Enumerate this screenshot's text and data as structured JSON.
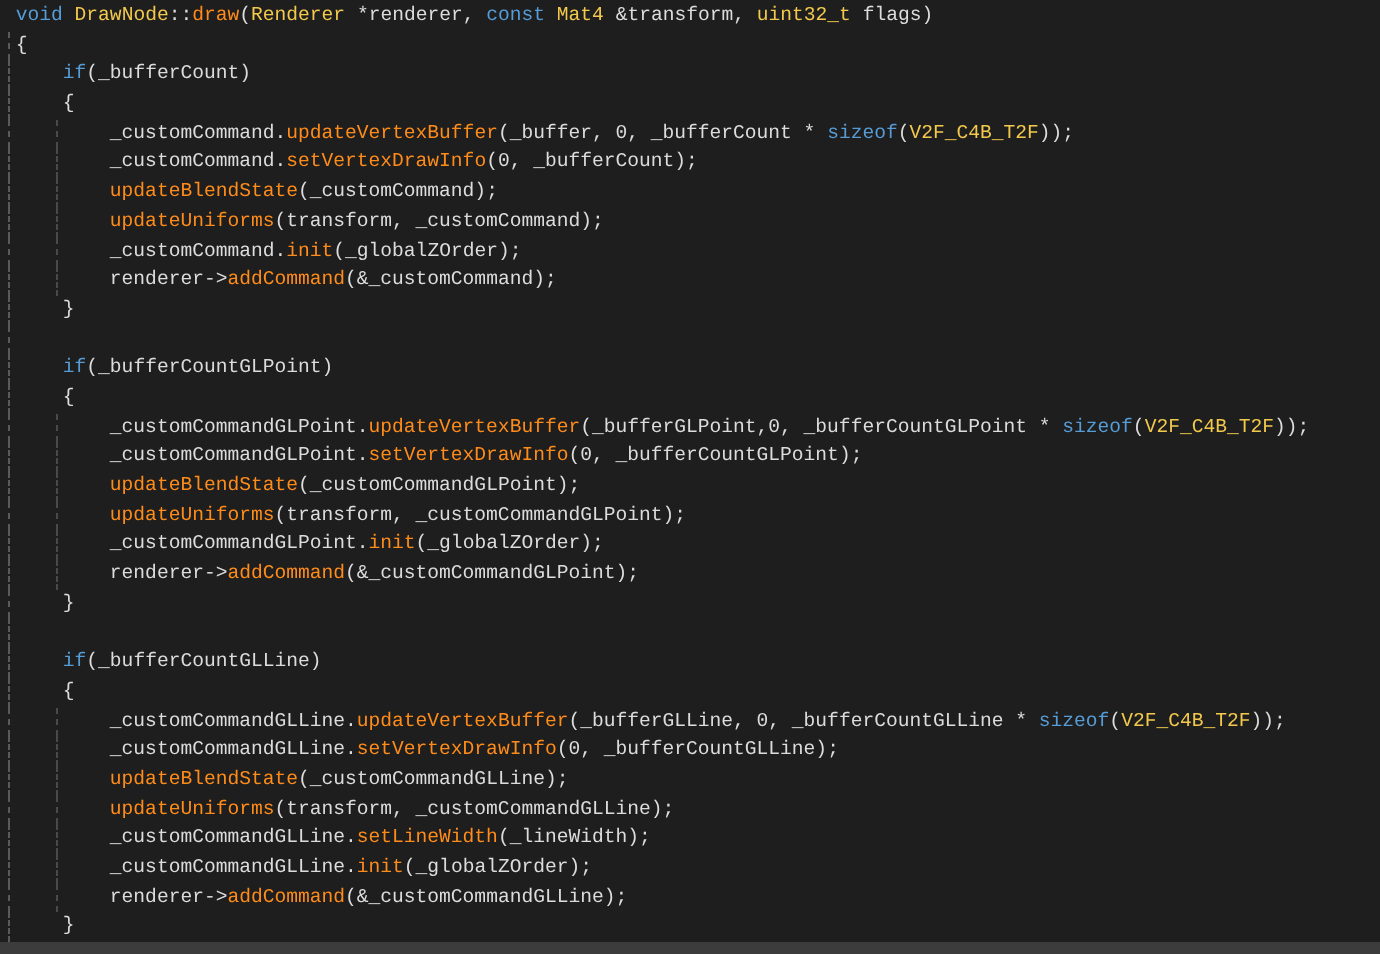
{
  "editor": {
    "lines": [
      {
        "kind": "code",
        "tokens": [
          {
            "text": "void ",
            "kind": "keyword"
          },
          {
            "text": "DrawNode",
            "kind": "type"
          },
          {
            "text": "::",
            "kind": "plain"
          },
          {
            "text": "draw",
            "kind": "function"
          },
          {
            "text": "(",
            "kind": "plain"
          },
          {
            "text": "Renderer",
            "kind": "type"
          },
          {
            "text": " *renderer, ",
            "kind": "plain"
          },
          {
            "text": "const ",
            "kind": "keyword"
          },
          {
            "text": "Mat4",
            "kind": "type"
          },
          {
            "text": " &transform, ",
            "kind": "plain"
          },
          {
            "text": "uint32_t",
            "kind": "type"
          },
          {
            "text": " flags)",
            "kind": "plain"
          }
        ]
      },
      {
        "kind": "code",
        "tokens": [
          {
            "text": "{",
            "kind": "plain"
          }
        ]
      },
      {
        "kind": "code",
        "tokens": [
          {
            "text": "    if",
            "kind": "keyword"
          },
          {
            "text": "(_bufferCount)",
            "kind": "plain"
          }
        ]
      },
      {
        "kind": "code",
        "tokens": [
          {
            "text": "    {",
            "kind": "plain"
          }
        ]
      },
      {
        "kind": "code",
        "tokens": [
          {
            "text": "        _customCommand.",
            "kind": "plain"
          },
          {
            "text": "updateVertexBuffer",
            "kind": "function"
          },
          {
            "text": "(_buffer, 0, _bufferCount * ",
            "kind": "plain"
          },
          {
            "text": "sizeof",
            "kind": "keyword"
          },
          {
            "text": "(",
            "kind": "plain"
          },
          {
            "text": "V2F_C4B_T2F",
            "kind": "type"
          },
          {
            "text": "));",
            "kind": "plain"
          }
        ]
      },
      {
        "kind": "code",
        "tokens": [
          {
            "text": "        _customCommand.",
            "kind": "plain"
          },
          {
            "text": "setVertexDrawInfo",
            "kind": "function"
          },
          {
            "text": "(0, _bufferCount);",
            "kind": "plain"
          }
        ]
      },
      {
        "kind": "code",
        "tokens": [
          {
            "text": "        updateBlendState",
            "kind": "function"
          },
          {
            "text": "(_customCommand);",
            "kind": "plain"
          }
        ]
      },
      {
        "kind": "code",
        "tokens": [
          {
            "text": "        updateUniforms",
            "kind": "function"
          },
          {
            "text": "(transform, _customCommand);",
            "kind": "plain"
          }
        ]
      },
      {
        "kind": "code",
        "tokens": [
          {
            "text": "        _customCommand.",
            "kind": "plain"
          },
          {
            "text": "init",
            "kind": "function"
          },
          {
            "text": "(_globalZOrder);",
            "kind": "plain"
          }
        ]
      },
      {
        "kind": "code",
        "tokens": [
          {
            "text": "        renderer->",
            "kind": "plain"
          },
          {
            "text": "addCommand",
            "kind": "function"
          },
          {
            "text": "(&_customCommand);",
            "kind": "plain"
          }
        ]
      },
      {
        "kind": "code",
        "tokens": [
          {
            "text": "    }",
            "kind": "plain"
          }
        ]
      },
      {
        "kind": "blank"
      },
      {
        "kind": "code",
        "tokens": [
          {
            "text": "    if",
            "kind": "keyword"
          },
          {
            "text": "(_bufferCountGLPoint)",
            "kind": "plain"
          }
        ]
      },
      {
        "kind": "code",
        "tokens": [
          {
            "text": "    {",
            "kind": "plain"
          }
        ]
      },
      {
        "kind": "code",
        "tokens": [
          {
            "text": "        _customCommandGLPoint.",
            "kind": "plain"
          },
          {
            "text": "updateVertexBuffer",
            "kind": "function"
          },
          {
            "text": "(_bufferGLPoint,0, _bufferCountGLPoint * ",
            "kind": "plain"
          },
          {
            "text": "sizeof",
            "kind": "keyword"
          },
          {
            "text": "(",
            "kind": "plain"
          },
          {
            "text": "V2F_C4B_T2F",
            "kind": "type"
          },
          {
            "text": "));",
            "kind": "plain"
          }
        ]
      },
      {
        "kind": "code",
        "tokens": [
          {
            "text": "        _customCommandGLPoint.",
            "kind": "plain"
          },
          {
            "text": "setVertexDrawInfo",
            "kind": "function"
          },
          {
            "text": "(0, _bufferCountGLPoint);",
            "kind": "plain"
          }
        ]
      },
      {
        "kind": "code",
        "tokens": [
          {
            "text": "        updateBlendState",
            "kind": "function"
          },
          {
            "text": "(_customCommandGLPoint);",
            "kind": "plain"
          }
        ]
      },
      {
        "kind": "code",
        "tokens": [
          {
            "text": "        updateUniforms",
            "kind": "function"
          },
          {
            "text": "(transform, _customCommandGLPoint);",
            "kind": "plain"
          }
        ]
      },
      {
        "kind": "code",
        "tokens": [
          {
            "text": "        _customCommandGLPoint.",
            "kind": "plain"
          },
          {
            "text": "init",
            "kind": "function"
          },
          {
            "text": "(_globalZOrder);",
            "kind": "plain"
          }
        ]
      },
      {
        "kind": "code",
        "tokens": [
          {
            "text": "        renderer->",
            "kind": "plain"
          },
          {
            "text": "addCommand",
            "kind": "function"
          },
          {
            "text": "(&_customCommandGLPoint);",
            "kind": "plain"
          }
        ]
      },
      {
        "kind": "code",
        "tokens": [
          {
            "text": "    }",
            "kind": "plain"
          }
        ]
      },
      {
        "kind": "blank"
      },
      {
        "kind": "code",
        "tokens": [
          {
            "text": "    if",
            "kind": "keyword"
          },
          {
            "text": "(_bufferCountGLLine)",
            "kind": "plain"
          }
        ]
      },
      {
        "kind": "code",
        "tokens": [
          {
            "text": "    {",
            "kind": "plain"
          }
        ]
      },
      {
        "kind": "code",
        "tokens": [
          {
            "text": "        _customCommandGLLine.",
            "kind": "plain"
          },
          {
            "text": "updateVertexBuffer",
            "kind": "function"
          },
          {
            "text": "(_bufferGLLine, 0, _bufferCountGLLine * ",
            "kind": "plain"
          },
          {
            "text": "sizeof",
            "kind": "keyword"
          },
          {
            "text": "(",
            "kind": "plain"
          },
          {
            "text": "V2F_C4B_T2F",
            "kind": "type"
          },
          {
            "text": "));",
            "kind": "plain"
          }
        ]
      },
      {
        "kind": "code",
        "tokens": [
          {
            "text": "        _customCommandGLLine.",
            "kind": "plain"
          },
          {
            "text": "setVertexDrawInfo",
            "kind": "function"
          },
          {
            "text": "(0, _bufferCountGLLine);",
            "kind": "plain"
          }
        ]
      },
      {
        "kind": "code",
        "tokens": [
          {
            "text": "        updateBlendState",
            "kind": "function"
          },
          {
            "text": "(_customCommandGLLine);",
            "kind": "plain"
          }
        ]
      },
      {
        "kind": "code",
        "tokens": [
          {
            "text": "        updateUniforms",
            "kind": "function"
          },
          {
            "text": "(transform, _customCommandGLLine);",
            "kind": "plain"
          }
        ]
      },
      {
        "kind": "code",
        "tokens": [
          {
            "text": "        _customCommandGLLine.",
            "kind": "plain"
          },
          {
            "text": "setLineWidth",
            "kind": "function"
          },
          {
            "text": "(_lineWidth);",
            "kind": "plain"
          }
        ]
      },
      {
        "kind": "code",
        "tokens": [
          {
            "text": "        _customCommandGLLine.",
            "kind": "plain"
          },
          {
            "text": "init",
            "kind": "function"
          },
          {
            "text": "(_globalZOrder);",
            "kind": "plain"
          }
        ]
      },
      {
        "kind": "code",
        "tokens": [
          {
            "text": "        renderer->",
            "kind": "plain"
          },
          {
            "text": "addCommand",
            "kind": "function"
          },
          {
            "text": "(&_customCommandGLLine);",
            "kind": "plain"
          }
        ]
      },
      {
        "kind": "code",
        "tokens": [
          {
            "text": "    }",
            "kind": "plain"
          }
        ]
      }
    ]
  }
}
